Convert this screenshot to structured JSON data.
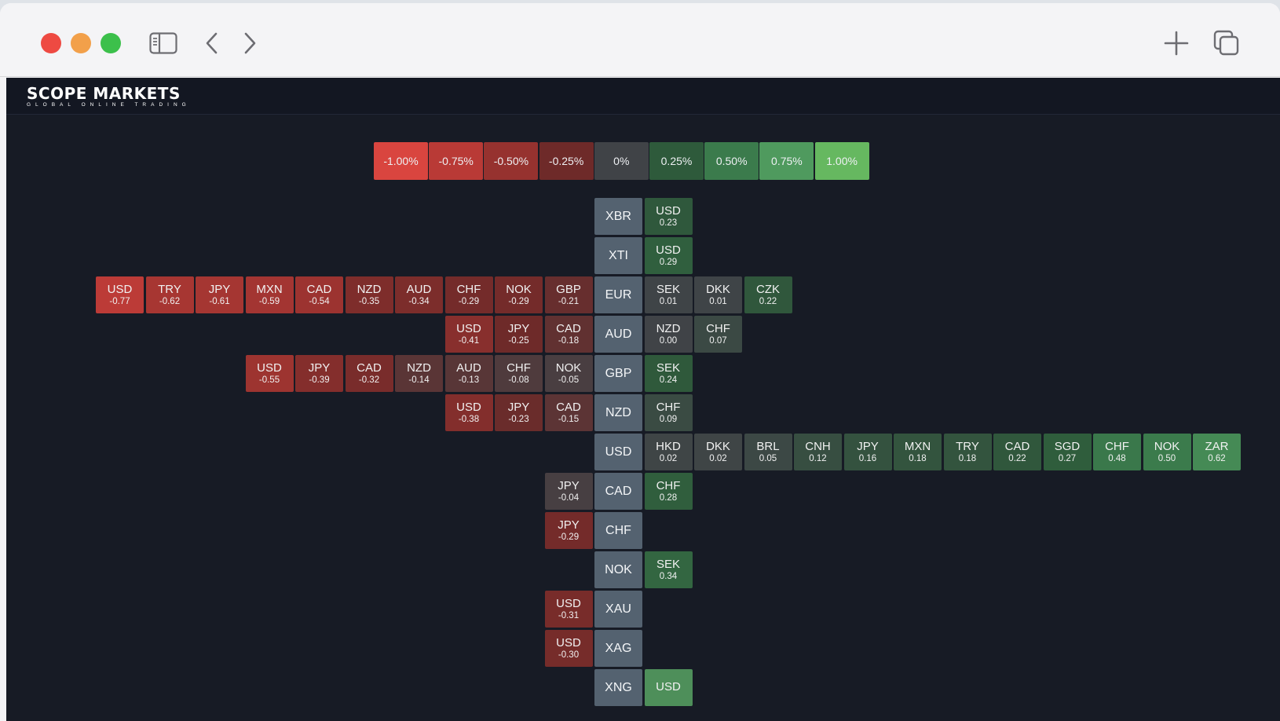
{
  "browser": {
    "toolbar_icons": [
      "sidebar-icon",
      "back-icon",
      "forward-icon",
      "new-tab-icon",
      "tabs-overview-icon"
    ]
  },
  "brand": {
    "name": "SCOPE MARKETS",
    "tagline": "GLOBAL ONLINE TRADING"
  },
  "legend": [
    {
      "label": "-1.00%",
      "color": "#d9453f"
    },
    {
      "label": "-0.75%",
      "color": "#b93a36"
    },
    {
      "label": "-0.50%",
      "color": "#96322f"
    },
    {
      "label": "-0.25%",
      "color": "#6e2a29"
    },
    {
      "label": "0%",
      "color": "#404347"
    },
    {
      "label": "0.25%",
      "color": "#2e5a3b"
    },
    {
      "label": "0.50%",
      "color": "#3b7b4c"
    },
    {
      "label": "0.75%",
      "color": "#4f9a5e"
    },
    {
      "label": "1.00%",
      "color": "#66b860"
    }
  ],
  "heatmap": [
    {
      "base": "XBR",
      "left": [],
      "right": [
        {
          "cur": "USD",
          "val": "0.23"
        }
      ]
    },
    {
      "base": "XTI",
      "left": [],
      "right": [
        {
          "cur": "USD",
          "val": "0.29"
        }
      ]
    },
    {
      "base": "EUR",
      "left": [
        {
          "cur": "USD",
          "val": "-0.77"
        },
        {
          "cur": "TRY",
          "val": "-0.62"
        },
        {
          "cur": "JPY",
          "val": "-0.61"
        },
        {
          "cur": "MXN",
          "val": "-0.59"
        },
        {
          "cur": "CAD",
          "val": "-0.54"
        },
        {
          "cur": "NZD",
          "val": "-0.35"
        },
        {
          "cur": "AUD",
          "val": "-0.34"
        },
        {
          "cur": "CHF",
          "val": "-0.29"
        },
        {
          "cur": "NOK",
          "val": "-0.29"
        },
        {
          "cur": "GBP",
          "val": "-0.21"
        }
      ],
      "right": [
        {
          "cur": "SEK",
          "val": "0.01"
        },
        {
          "cur": "DKK",
          "val": "0.01"
        },
        {
          "cur": "CZK",
          "val": "0.22"
        }
      ]
    },
    {
      "base": "AUD",
      "left": [
        {
          "cur": "USD",
          "val": "-0.41"
        },
        {
          "cur": "JPY",
          "val": "-0.25"
        },
        {
          "cur": "CAD",
          "val": "-0.18"
        }
      ],
      "right": [
        {
          "cur": "NZD",
          "val": "0.00"
        },
        {
          "cur": "CHF",
          "val": "0.07"
        }
      ]
    },
    {
      "base": "GBP",
      "left": [
        {
          "cur": "USD",
          "val": "-0.55"
        },
        {
          "cur": "JPY",
          "val": "-0.39"
        },
        {
          "cur": "CAD",
          "val": "-0.32"
        },
        {
          "cur": "NZD",
          "val": "-0.14"
        },
        {
          "cur": "AUD",
          "val": "-0.13"
        },
        {
          "cur": "CHF",
          "val": "-0.08"
        },
        {
          "cur": "NOK",
          "val": "-0.05"
        }
      ],
      "right": [
        {
          "cur": "SEK",
          "val": "0.24"
        }
      ]
    },
    {
      "base": "NZD",
      "left": [
        {
          "cur": "USD",
          "val": "-0.38"
        },
        {
          "cur": "JPY",
          "val": "-0.23"
        },
        {
          "cur": "CAD",
          "val": "-0.15"
        }
      ],
      "right": [
        {
          "cur": "CHF",
          "val": "0.09"
        }
      ]
    },
    {
      "base": "USD",
      "left": [],
      "right": [
        {
          "cur": "HKD",
          "val": "0.02"
        },
        {
          "cur": "DKK",
          "val": "0.02"
        },
        {
          "cur": "BRL",
          "val": "0.05"
        },
        {
          "cur": "CNH",
          "val": "0.12"
        },
        {
          "cur": "JPY",
          "val": "0.16"
        },
        {
          "cur": "MXN",
          "val": "0.18"
        },
        {
          "cur": "TRY",
          "val": "0.18"
        },
        {
          "cur": "CAD",
          "val": "0.22"
        },
        {
          "cur": "SGD",
          "val": "0.27"
        },
        {
          "cur": "CHF",
          "val": "0.48"
        },
        {
          "cur": "NOK",
          "val": "0.50"
        },
        {
          "cur": "ZAR",
          "val": "0.62"
        }
      ]
    },
    {
      "base": "CAD",
      "left": [
        {
          "cur": "JPY",
          "val": "-0.04"
        }
      ],
      "right": [
        {
          "cur": "CHF",
          "val": "0.28"
        }
      ]
    },
    {
      "base": "CHF",
      "left": [
        {
          "cur": "JPY",
          "val": "-0.29"
        }
      ],
      "right": []
    },
    {
      "base": "NOK",
      "left": [],
      "right": [
        {
          "cur": "SEK",
          "val": "0.34"
        }
      ]
    },
    {
      "base": "XAU",
      "left": [
        {
          "cur": "USD",
          "val": "-0.31"
        }
      ],
      "right": []
    },
    {
      "base": "XAG",
      "left": [
        {
          "cur": "USD",
          "val": "-0.30"
        }
      ],
      "right": []
    },
    {
      "base": "XNG",
      "left": [],
      "right": [
        {
          "cur": "USD",
          "val": ""
        }
      ]
    }
  ]
}
